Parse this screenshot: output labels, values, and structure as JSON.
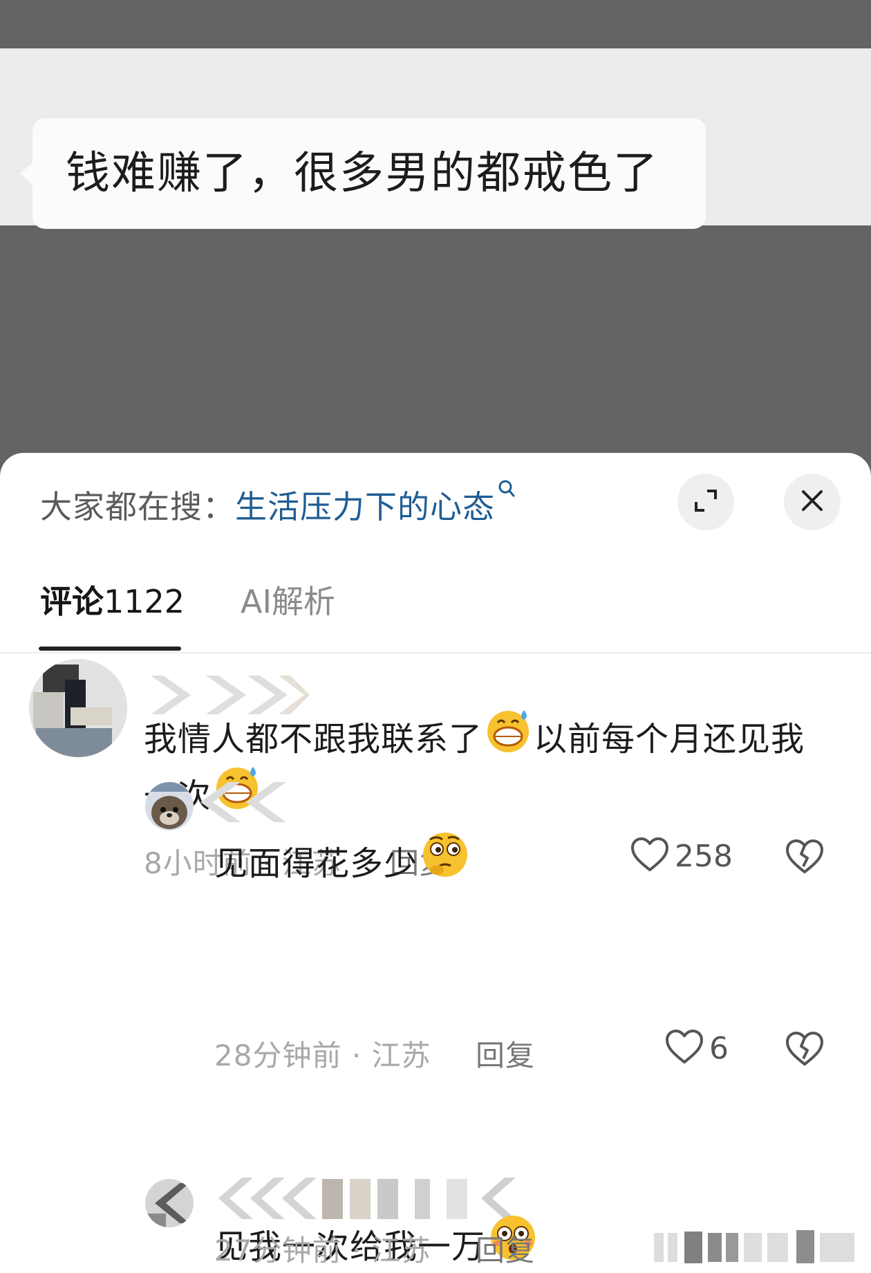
{
  "post": {
    "text": "钱难赚了，很多男的都戒色了"
  },
  "sheet": {
    "search_prefix": "大家都在搜：",
    "search_term": "生活压力下的心态",
    "tabs": [
      {
        "label": "评论",
        "count": "1122"
      },
      {
        "label": "AI解析"
      }
    ]
  },
  "comments": [
    {
      "text_part1": "我情人都不跟我联系了",
      "text_part2": "以前每个月还见我一次",
      "emoji": "grinning-sweat-emoji",
      "time": "8小时前",
      "location": "江苏",
      "reply_label": "回复",
      "likes": "258"
    },
    {
      "text": "见面得花多少",
      "emoji": "thinking-face-emoji",
      "time": "28分钟前",
      "location": "江苏",
      "reply_label": "回复",
      "likes": "6"
    },
    {
      "text": "见我一次给我一万",
      "emoji": "flushed-face-emoji",
      "time": "27分钟前",
      "location": "江苏",
      "reply_label": "回复"
    }
  ],
  "meta_separator": "·",
  "colors": {
    "backdrop": "#646464",
    "link_blue": "#1f5d94",
    "meta_gray": "#a8a8a8"
  }
}
